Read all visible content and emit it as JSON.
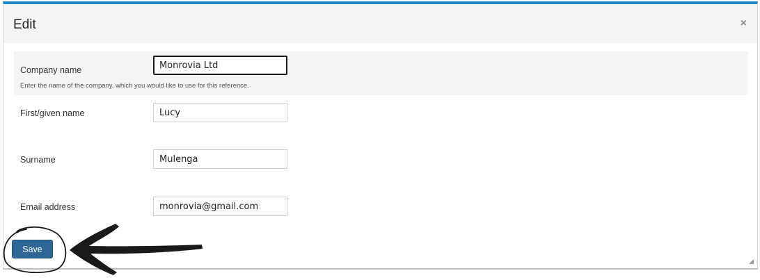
{
  "dialog": {
    "title": "Edit",
    "close_icon": "×"
  },
  "form": {
    "company": {
      "label": "Company name",
      "value": "Monrovia Ltd",
      "help": "Enter the name of the company, which you would like to use for this reference."
    },
    "first_name": {
      "label": "First/given name",
      "value": "Lucy"
    },
    "surname": {
      "label": "Surname",
      "value": "Mulenga"
    },
    "email": {
      "label": "Email address",
      "value": "monrovia@gmail.com"
    }
  },
  "actions": {
    "save_label": "Save"
  },
  "colors": {
    "accent": "#1f86c6",
    "button": "#2e6696",
    "header_bg": "#f4f4f4"
  }
}
